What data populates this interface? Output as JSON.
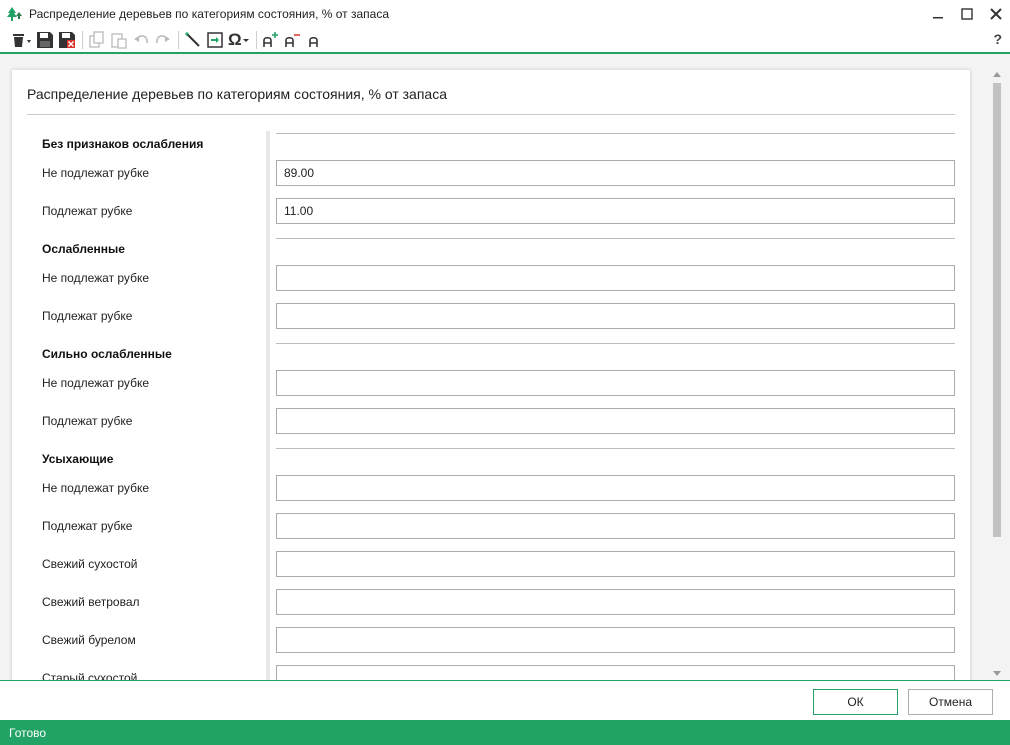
{
  "window": {
    "title": "Распределение деревьев по категориям состояния, % от запаса",
    "help": "?"
  },
  "toolbar": {
    "icons": [
      "delete-icon",
      "dropdown-icon",
      "save-icon",
      "save-close-icon",
      "copy-icon",
      "paste-icon",
      "undo-icon",
      "redo-icon",
      "wand-icon",
      "import-icon",
      "symbol-omega-icon",
      "font-increase-icon",
      "font-decrease-icon",
      "font-default-icon"
    ],
    "symbol_glyph": "Ω"
  },
  "form": {
    "header": "Распределение деревьев по категориям состояния, % от запаса",
    "sections": [
      {
        "title": "Без признаков ослабления",
        "rows": [
          {
            "label": "Не подлежат рубке",
            "value": "89.00"
          },
          {
            "label": "Подлежат рубке",
            "value": "11.00"
          }
        ]
      },
      {
        "title": "Ослабленные",
        "rows": [
          {
            "label": "Не подлежат рубке",
            "value": ""
          },
          {
            "label": "Подлежат рубке",
            "value": ""
          }
        ]
      },
      {
        "title": "Сильно ослабленные",
        "rows": [
          {
            "label": "Не подлежат рубке",
            "value": ""
          },
          {
            "label": "Подлежат рубке",
            "value": ""
          }
        ]
      },
      {
        "title": "Усыхающие",
        "rows": [
          {
            "label": "Не подлежат рубке",
            "value": ""
          },
          {
            "label": "Подлежат рубке",
            "value": ""
          },
          {
            "label": "Свежий сухостой",
            "value": ""
          },
          {
            "label": "Свежий ветровал",
            "value": ""
          },
          {
            "label": "Свежий бурелом",
            "value": ""
          },
          {
            "label": "Старый сухостой",
            "value": ""
          }
        ]
      }
    ]
  },
  "buttons": {
    "ok": "ОК",
    "cancel": "Отмена"
  },
  "status": {
    "text": "Готово"
  },
  "colors": {
    "accent": "#21a366"
  }
}
